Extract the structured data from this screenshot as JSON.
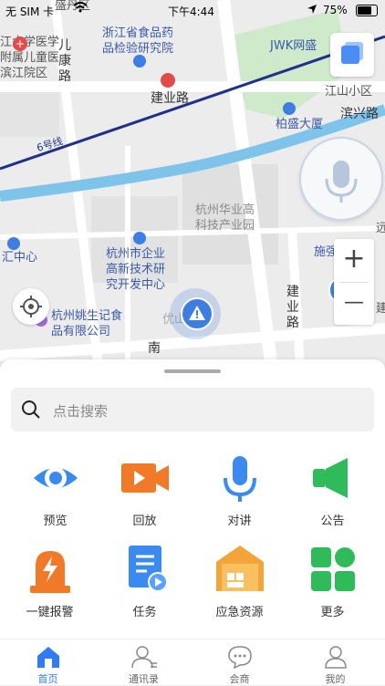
{
  "status_bar": {
    "carrier": "无 SIM 卡",
    "time": "下午4:44",
    "battery": "75%"
  },
  "map": {
    "labels": {
      "hospital": "江大学医学\n附属儿童医\n滨江院区",
      "area_top": "盛丹区",
      "food_institute": "浙江省食品药\n品检验研究院",
      "jianye_road": "建业路",
      "jwk": "JWK网盛",
      "jiangshan": "江山小区",
      "binxing": "滨兴路",
      "baisheng": "柏盛大厦",
      "metro_line": "6号线",
      "huaye": "杭州华业高\n科技产业园",
      "huicenter": "汇中心",
      "incubator": "杭州市企业\n高新技术研\n究开发中心",
      "shiqiang": "施强",
      "jianye_road_v": "建\n业\n路",
      "yaoji": "杭州姚生记食\n品有限公司",
      "youshan": "优山园",
      "nan": "南",
      "kang": "儿\n康\n路",
      "jian": "建",
      "yuan": "远"
    },
    "zoom_in": "+",
    "zoom_out": "—"
  },
  "search": {
    "placeholder": "点击搜索"
  },
  "grid": [
    {
      "label": "预览",
      "icon": "eye-icon"
    },
    {
      "label": "回放",
      "icon": "video-playback-icon"
    },
    {
      "label": "对讲",
      "icon": "microphone-icon"
    },
    {
      "label": "公告",
      "icon": "speaker-icon"
    },
    {
      "label": "一键报警",
      "icon": "alarm-light-icon"
    },
    {
      "label": "任务",
      "icon": "task-document-icon"
    },
    {
      "label": "应急资源",
      "icon": "warehouse-icon"
    },
    {
      "label": "更多",
      "icon": "more-apps-icon"
    }
  ],
  "tabs": [
    {
      "label": "首页",
      "icon": "home-icon",
      "active": true
    },
    {
      "label": "通讯录",
      "icon": "contacts-icon",
      "active": false
    },
    {
      "label": "会商",
      "icon": "chat-bubble-icon",
      "active": false
    },
    {
      "label": "我的",
      "icon": "profile-icon",
      "active": false
    }
  ],
  "colors": {
    "accent": "#2f7cf6",
    "orange": "#f07a28",
    "green": "#2fbb5a"
  }
}
